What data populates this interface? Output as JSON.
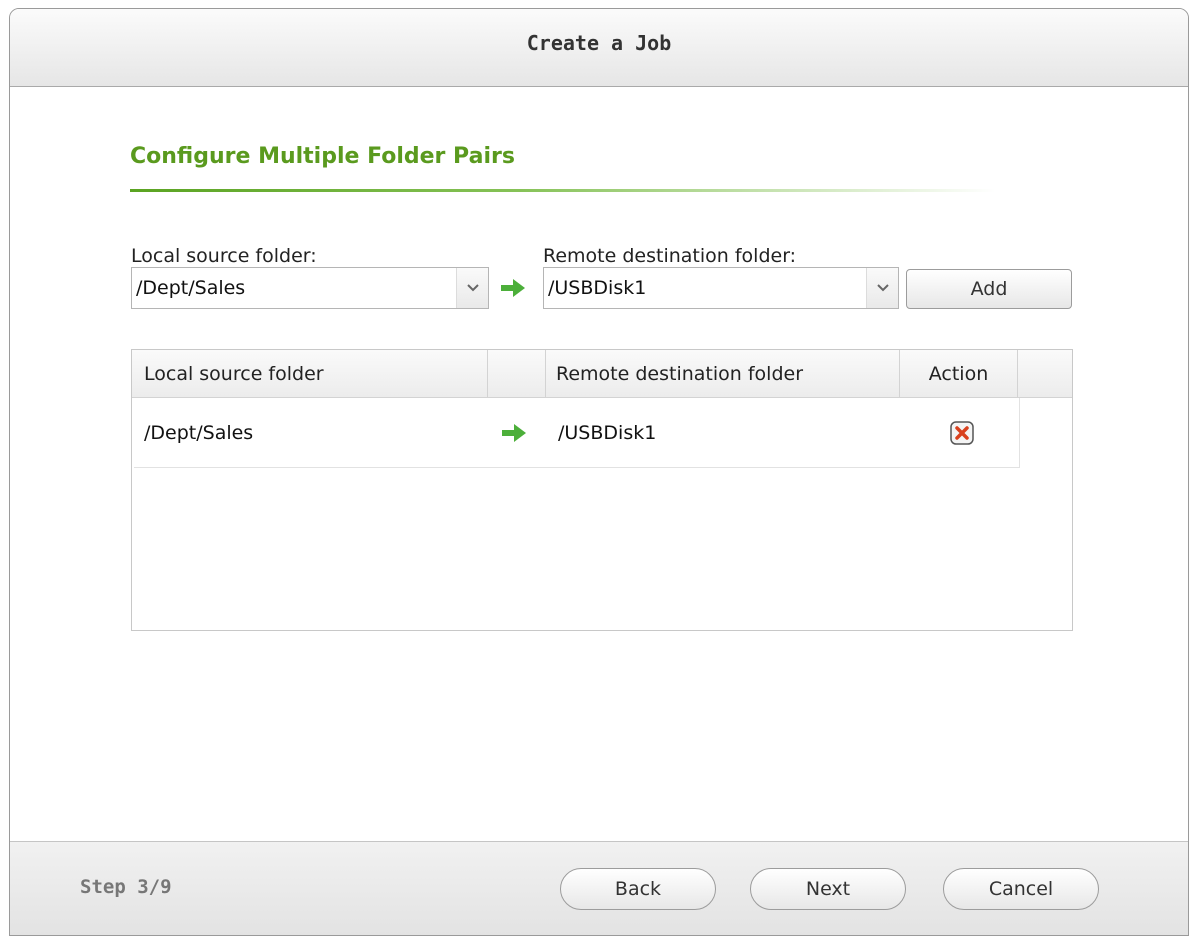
{
  "dialog": {
    "title": "Create a Job"
  },
  "section": {
    "title": "Configure Multiple Folder Pairs"
  },
  "pair_form": {
    "local_label": "Local source folder:",
    "local_value": "/Dept/Sales",
    "remote_label": "Remote destination folder:",
    "remote_value": "/USBDisk1",
    "add_label": "Add"
  },
  "table": {
    "columns": [
      "Local source folder",
      "",
      "Remote destination folder",
      "Action"
    ],
    "rows": [
      {
        "local": "/Dept/Sales",
        "remote": "/USBDisk1"
      }
    ]
  },
  "footer": {
    "step": "Step 3/9",
    "back_label": "Back",
    "next_label": "Next",
    "cancel_label": "Cancel"
  },
  "colors": {
    "accent_green": "#5a9a1e",
    "arrow_green": "#4caf3a",
    "delete_red": "#d9411e"
  },
  "icons": {
    "dropdown": "chevron-down-icon",
    "pair_arrow": "arrow-right-icon",
    "delete": "delete-x-icon"
  }
}
